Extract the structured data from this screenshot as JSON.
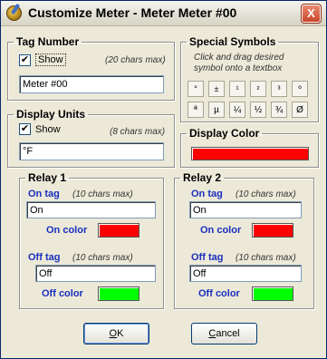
{
  "window": {
    "title": "Customize Meter - Meter Meter #00",
    "close_glyph": "X",
    "title_icon": "meter-app-icon"
  },
  "tag_number": {
    "legend": "Tag Number",
    "show_label": "Show",
    "show_checked": true,
    "check_glyph": "✔",
    "hint": "(20 chars max)",
    "value": "Meter #00"
  },
  "display_units": {
    "legend": "Display Units",
    "show_label": "Show",
    "show_checked": true,
    "check_glyph": "✔",
    "hint": "(8 chars max)",
    "value": "°F"
  },
  "special_symbols": {
    "legend": "Special Symbols",
    "instructions_line1": "Click and drag desired",
    "instructions_line2": "symbol onto a textbox",
    "row1": [
      "°",
      "±",
      "¹",
      "²",
      "³",
      "º"
    ],
    "row2": [
      "ª",
      "µ",
      "¼",
      "½",
      "¾",
      "Ø"
    ]
  },
  "display_color": {
    "legend": "Display Color",
    "color": "#ff0000"
  },
  "relay1": {
    "legend": "Relay 1",
    "on_tag_label": "On tag",
    "on_hint": "(10 chars max)",
    "on_value": "On",
    "on_color_label": "On color",
    "on_color": "#ff0000",
    "off_tag_label": "Off tag",
    "off_hint": "(10 chars max)",
    "off_value": "Off",
    "off_color_label": "Off color",
    "off_color": "#00ff00"
  },
  "relay2": {
    "legend": "Relay 2",
    "on_tag_label": "On tag",
    "on_hint": "(10 chars max)",
    "on_value": "On",
    "on_color_label": "On color",
    "on_color": "#ff0000",
    "off_tag_label": "Off tag",
    "off_hint": "(10 chars max)",
    "off_value": "Off",
    "off_color_label": "Off color",
    "off_color": "#00ff00"
  },
  "buttons": {
    "ok_label": "OK",
    "cancel_label": "Cancel"
  },
  "colors": {
    "accent_label": "#1a2fbf",
    "window_bg": "#ece9d8"
  }
}
